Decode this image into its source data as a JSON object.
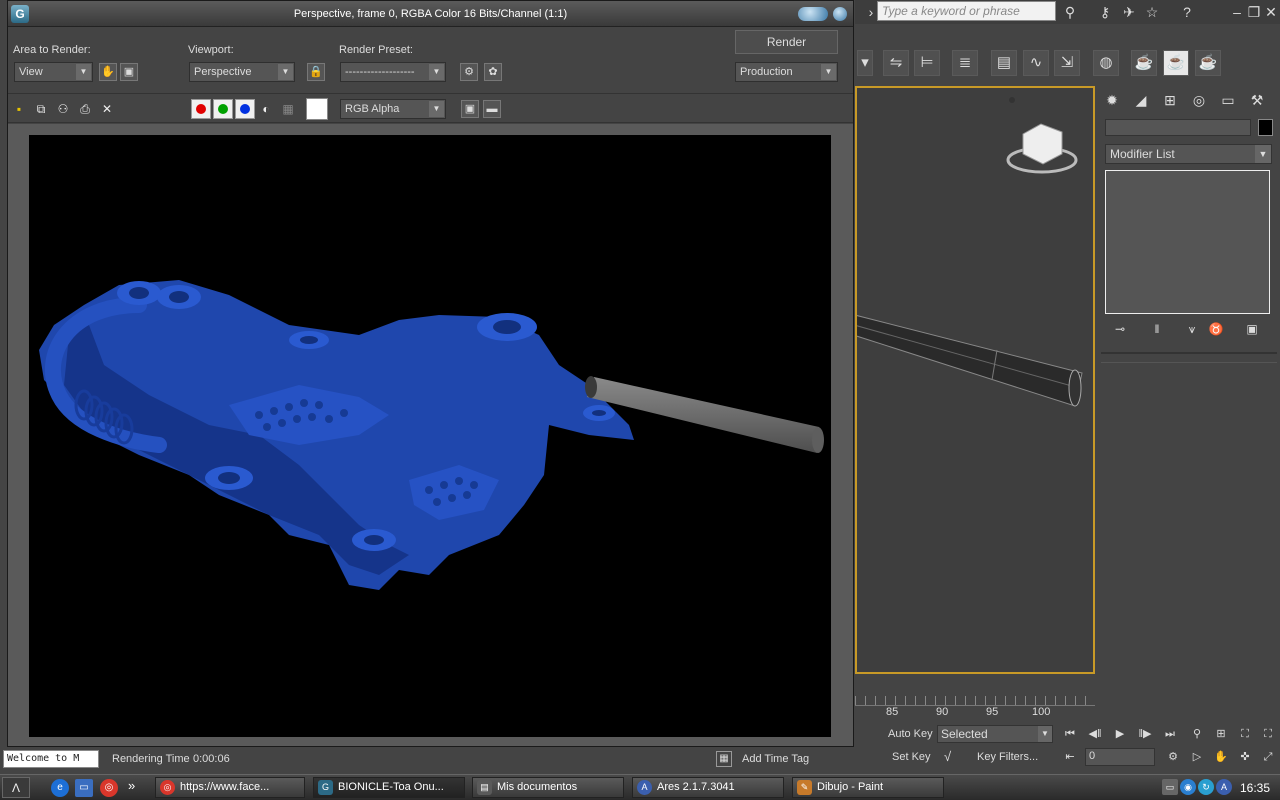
{
  "render_window": {
    "title": "Perspective, frame 0, RGBA Color 16 Bits/Channel (1:1)",
    "area_to_render_label": "Area to Render:",
    "area_to_render_value": "View",
    "viewport_label": "Viewport:",
    "viewport_value": "Perspective",
    "render_preset_label": "Render Preset:",
    "render_preset_value": "-------------------",
    "render_button": "Render",
    "render_mode_value": "Production",
    "channel_value": "RGB Alpha",
    "colors": {
      "red": "#e00000",
      "green": "#00a000",
      "blue": "#0030e0",
      "model": "#1f47ad",
      "rod": "#6e6e6e"
    }
  },
  "app": {
    "search_placeholder": "Type a keyword or phrase",
    "modifier_list": "Modifier List",
    "timeline_ticks": [
      "85",
      "90",
      "95",
      "100"
    ],
    "auto_key": "Auto Key",
    "set_key": "Set Key",
    "selected_value": "Selected",
    "key_filters": "Key Filters...",
    "current_frame": "0",
    "accent": "#c89a27"
  },
  "status": {
    "welcome": "Welcome to M",
    "rendering_time_label": "Rendering Time",
    "rendering_time_value": "0:00:06",
    "add_time_tag": "Add Time Tag"
  },
  "taskbar": {
    "items": [
      {
        "label": "https://www.face..."
      },
      {
        "label": "BIONICLE-Toa Onu..."
      },
      {
        "label": "Mis documentos"
      },
      {
        "label": "Ares 2.1.7.3041"
      },
      {
        "label": "Dibujo - Paint"
      }
    ],
    "overflow": "»",
    "clock": "16:35"
  }
}
